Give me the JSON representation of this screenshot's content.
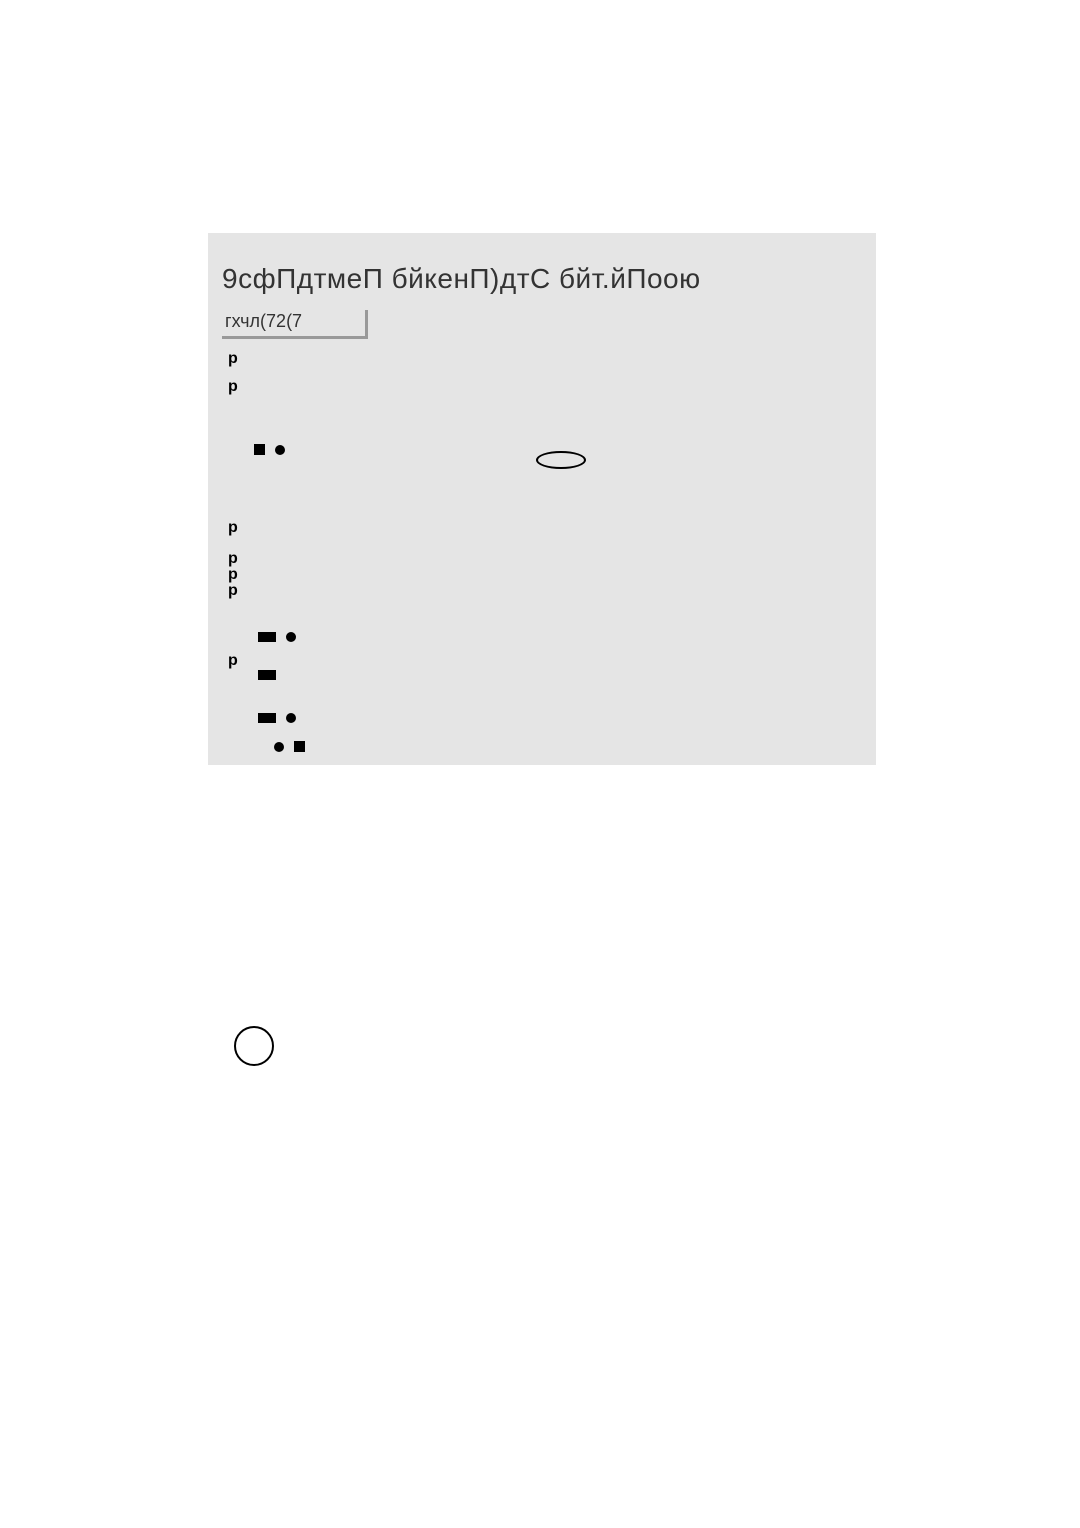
{
  "title": "9сфПдтмеП бйкенП)дтС бйт.йПоою",
  "tab": "гхчл(72(7",
  "bullets": {
    "p": "p"
  }
}
